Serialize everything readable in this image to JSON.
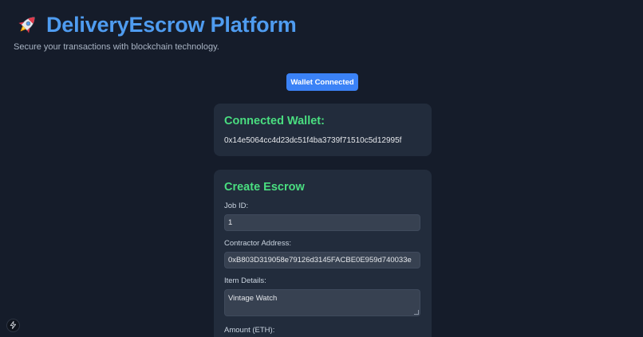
{
  "header": {
    "title": "DeliveryEscrow Platform",
    "subtitle": "Secure your transactions with blockchain technology."
  },
  "wallet_button": {
    "label": "Wallet Connected"
  },
  "wallet_card": {
    "heading": "Connected Wallet:",
    "address": "0x14e5064cc4d23dc51f4ba3739f71510c5d12995f"
  },
  "escrow_card": {
    "heading": "Create Escrow",
    "fields": {
      "job_id": {
        "label": "Job ID:",
        "value": "1"
      },
      "contractor": {
        "label": "Contractor Address:",
        "value": "0xB803D319058e79126d3145FACBE0E959d740033e"
      },
      "item_details": {
        "label": "Item Details:",
        "value": "Vintage Watch"
      },
      "amount": {
        "label": "Amount (ETH):"
      }
    }
  },
  "icons": {
    "title_icon": "rocket-icon",
    "corner_icon": "lightning-bolt-icon"
  },
  "colors": {
    "background": "#151c2a",
    "card": "#222c3c",
    "title": "#4f9cf0",
    "heading": "#4ade80",
    "button": "#3b82f6"
  }
}
